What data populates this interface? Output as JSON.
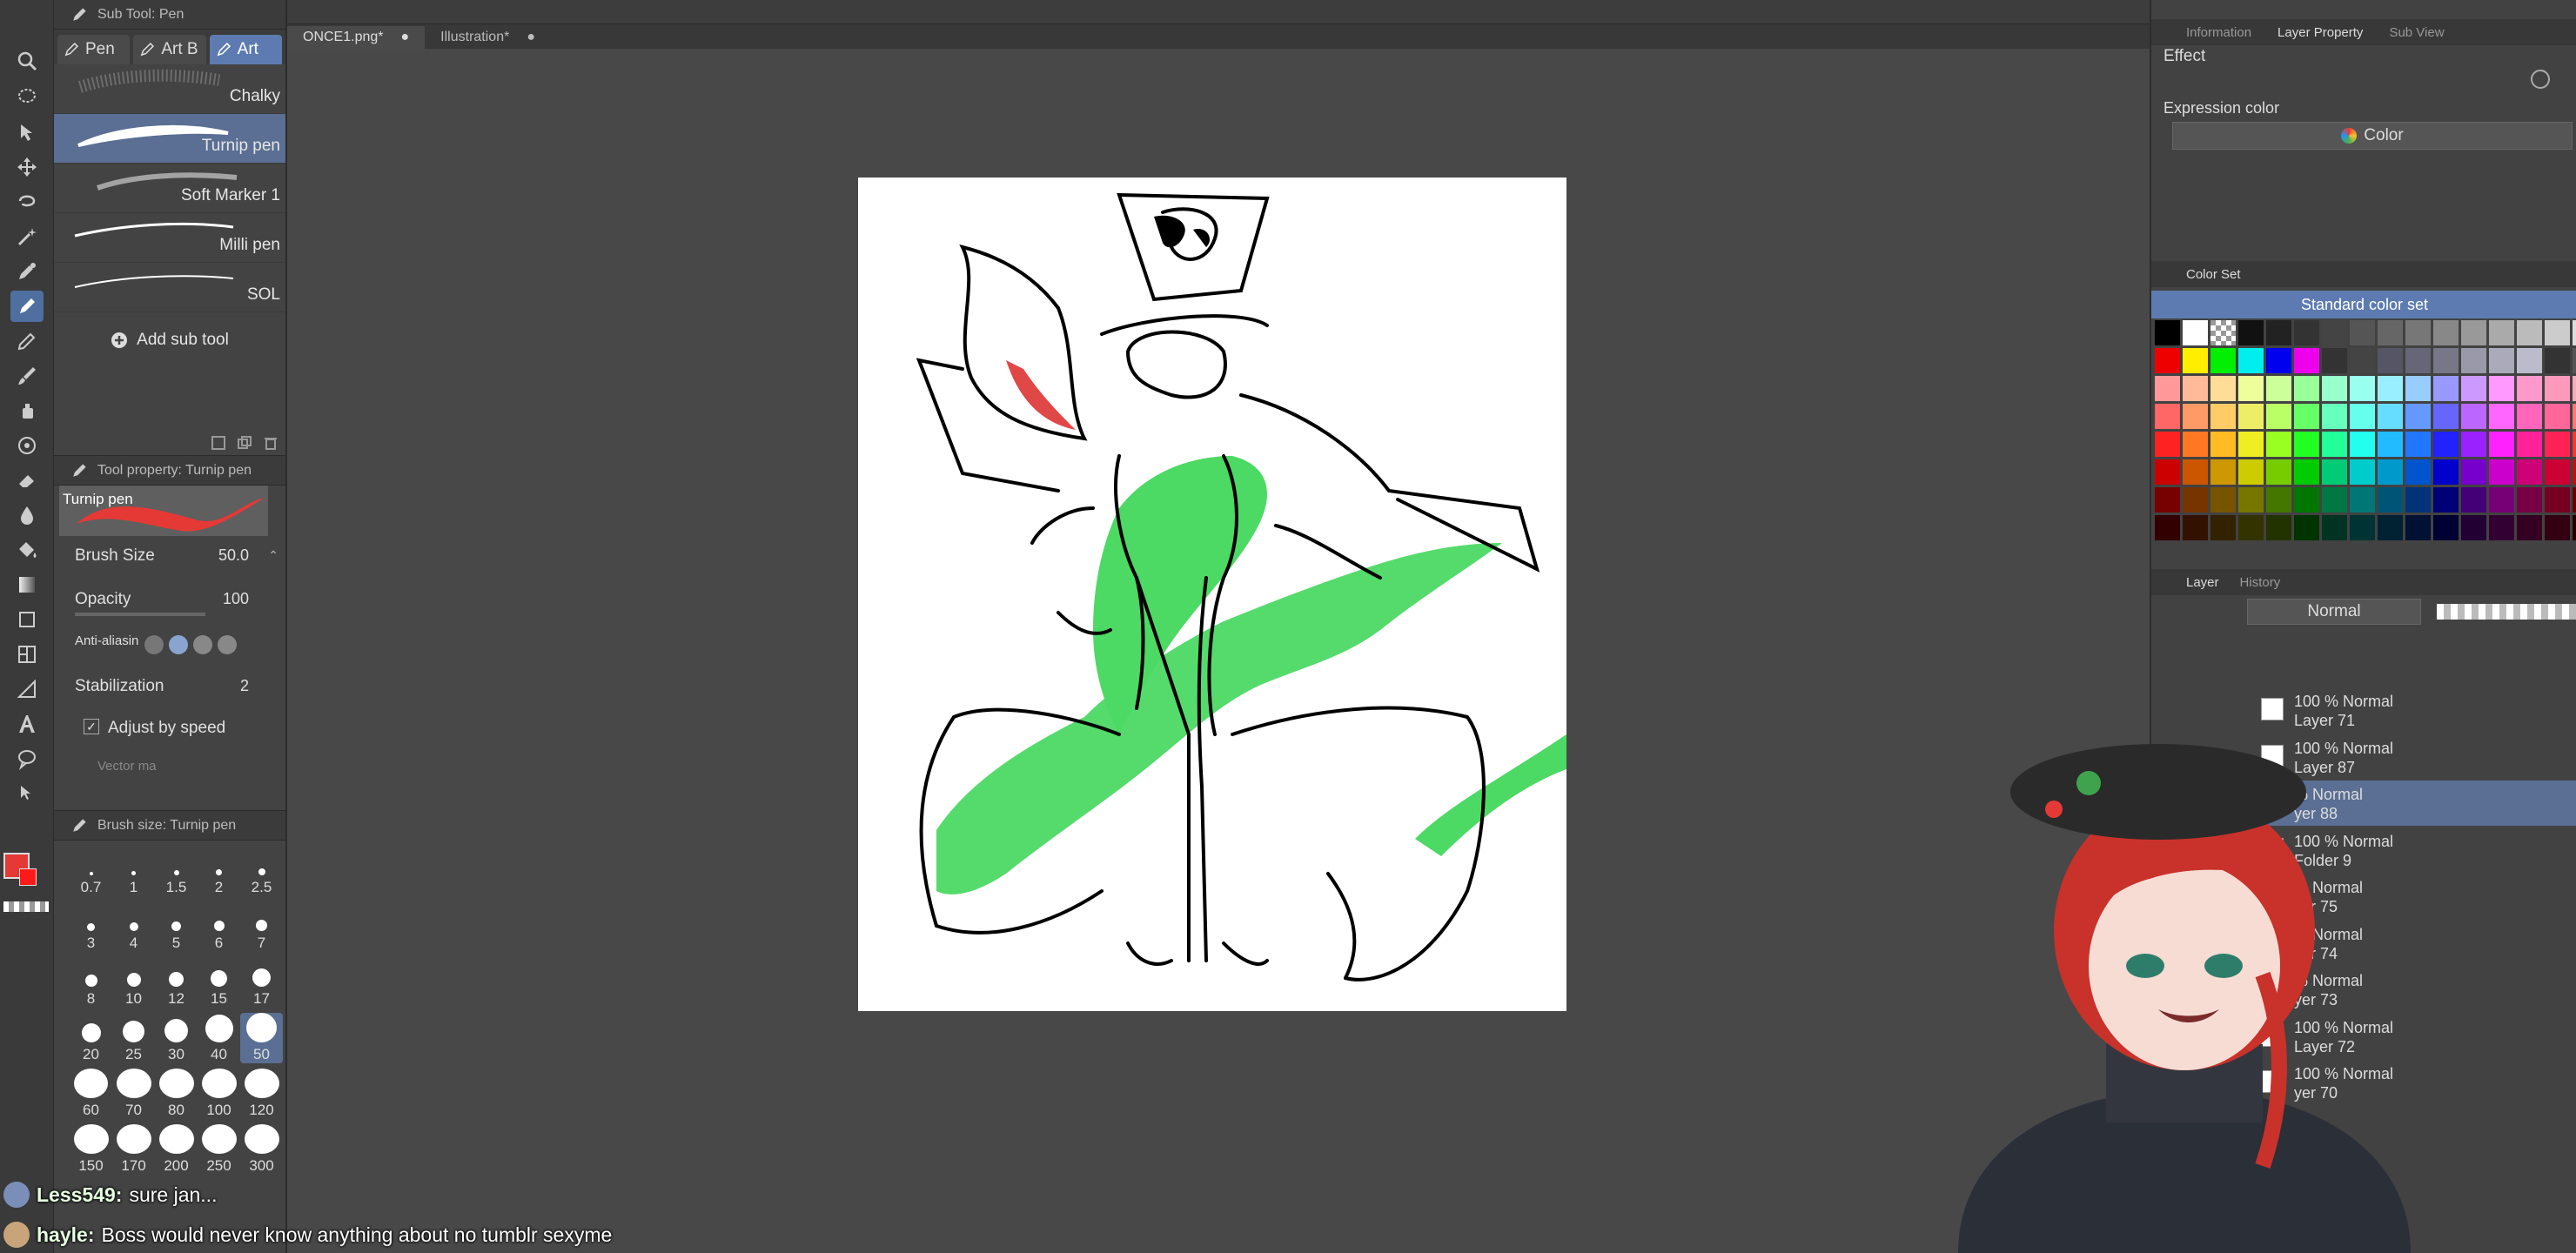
{
  "app": {
    "accent": "#5d7bb0",
    "bg": "#474747"
  },
  "file_tabs": [
    {
      "label": "ONCE1.png*",
      "close": "●"
    },
    {
      "label": "Illustration*",
      "close": "●"
    }
  ],
  "subtool": {
    "header": "Sub Tool: Pen",
    "tabs": [
      {
        "label": "Pen",
        "icon": "pen-icon"
      },
      {
        "label": "Art B",
        "icon": "pen-icon"
      },
      {
        "label": "Art",
        "icon": "pen-icon"
      }
    ],
    "brushes": [
      {
        "label": "Chalky"
      },
      {
        "label": "Turnip pen"
      },
      {
        "label": "Soft Marker 1"
      },
      {
        "label": "Milli pen"
      },
      {
        "label": "SOL"
      }
    ],
    "add_label": "Add sub tool"
  },
  "tool_property": {
    "header": "Tool property: Turnip pen",
    "preview_label": "Turnip pen",
    "brush_size": {
      "label": "Brush Size",
      "value": "50.0"
    },
    "opacity": {
      "label": "Opacity",
      "value": "100"
    },
    "antialias": {
      "label": "Anti-aliasin"
    },
    "stabilization": {
      "label": "Stabilization",
      "value": "2"
    },
    "adjust": {
      "label": "Adjust by speed"
    },
    "vector": {
      "label": "Vector ma"
    }
  },
  "brush_size_panel": {
    "header": "Brush size: Turnip pen",
    "sizes": [
      "0.7",
      "1",
      "1.5",
      "2",
      "2.5",
      "3",
      "4",
      "5",
      "6",
      "7",
      "8",
      "10",
      "12",
      "15",
      "17",
      "20",
      "25",
      "30",
      "40",
      "50",
      "60",
      "70",
      "80",
      "100",
      "120",
      "150",
      "170",
      "200",
      "250",
      "300"
    ],
    "selected": "50"
  },
  "right": {
    "top_tabs": [
      "Information",
      "Layer Property",
      "Sub View"
    ],
    "effect_label": "Effect",
    "expression_label": "Expression color",
    "expression_value": "Color",
    "colorset_tab": "Color Set",
    "colorset_name": "Standard color set",
    "layer_tabs": [
      "Layer",
      "History"
    ],
    "blend_mode": "Normal",
    "layers": [
      {
        "opacity": "100 %",
        "mode": "Normal",
        "name": "Layer 71"
      },
      {
        "opacity": "100 %",
        "mode": "Normal",
        "name": "Layer 87"
      },
      {
        "opacity": "%",
        "mode": "Normal",
        "name": "yer 88"
      },
      {
        "opacity": "100 %",
        "mode": "Normal",
        "name": "Folder 9"
      },
      {
        "opacity": "%",
        "mode": "Normal",
        "name": "yer 75"
      },
      {
        "opacity": "%",
        "mode": "Normal",
        "name": "yer 74"
      },
      {
        "opacity": "%",
        "mode": "Normal",
        "name": "yer 73"
      },
      {
        "opacity": "100 %",
        "mode": "Normal",
        "name": "Layer 72"
      },
      {
        "opacity": "100 %",
        "mode": "Normal",
        "name": "yer 70"
      }
    ]
  },
  "chat": [
    {
      "user": "Less549:",
      "message": "sure jan..."
    },
    {
      "user": "hayle:",
      "message": "Boss would never know anything about no tumblr sexyme"
    }
  ],
  "colors": {
    "fg": "#e53935",
    "sketch_green": "#4cd964",
    "sketch_red": "#e04848"
  }
}
